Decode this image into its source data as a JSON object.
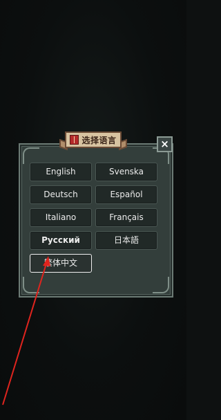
{
  "dialog": {
    "title": "选择语言",
    "close_label": "×",
    "languages": [
      {
        "label": "English"
      },
      {
        "label": "Svenska"
      },
      {
        "label": "Deutsch"
      },
      {
        "label": "Español"
      },
      {
        "label": "Italiano"
      },
      {
        "label": "Français"
      },
      {
        "label": "Русский"
      },
      {
        "label": "日本語"
      },
      {
        "label": "繁体中文",
        "selected": true
      }
    ]
  },
  "annotation": {
    "color": "#e0241e"
  },
  "colors": {
    "panel": "#333e3b",
    "button": "#212927",
    "banner": "#d8c3a1",
    "background": "#0e1111"
  }
}
